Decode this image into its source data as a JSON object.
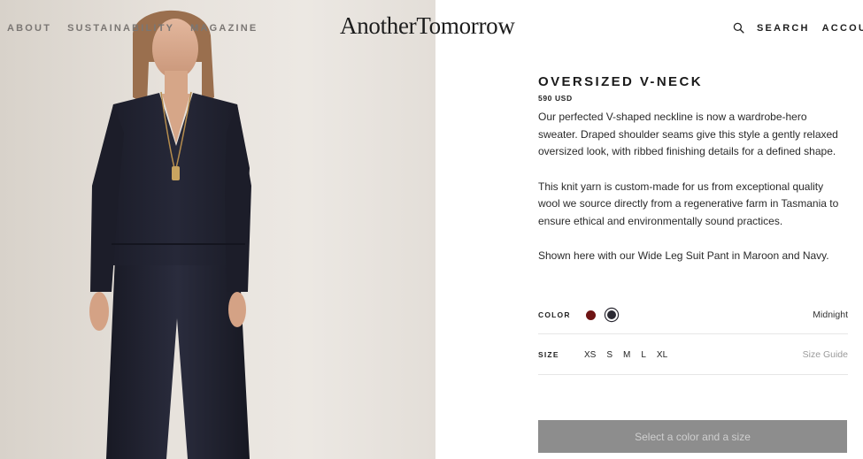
{
  "header": {
    "nav_left": [
      "ABOUT",
      "SUSTAINABILITY",
      "MAGAZINE"
    ],
    "logo": "AnotherTomorrow",
    "search_label": "SEARCH",
    "account_label": "ACCOU"
  },
  "product": {
    "title": "OVERSIZED V-NECK",
    "price": "590 USD",
    "description": [
      "Our perfected V-shaped neckline is now a wardrobe-hero sweater. Draped shoulder seams give this style a gently relaxed oversized look, with ribbed finishing details for a defined shape.",
      "This knit yarn is custom-made for us from exceptional quality wool we source directly from a regenerative farm in Tasmania to ensure ethical and environmentally sound practices.",
      "Shown here with our Wide Leg Suit Pant in Maroon and Navy."
    ]
  },
  "options": {
    "color_label": "COLOR",
    "colors": [
      {
        "name": "Maroon",
        "hex": "#6e1414",
        "selected": false
      },
      {
        "name": "Midnight",
        "hex": "#2b2a33",
        "selected": true
      }
    ],
    "selected_color_name": "Midnight",
    "size_label": "SIZE",
    "sizes": [
      "XS",
      "S",
      "M",
      "L",
      "XL"
    ],
    "size_guide": "Size Guide"
  },
  "cta": {
    "label": "Select a color and a size",
    "enabled": false
  },
  "colors": {
    "cta_bg": "#8d8d8d",
    "cta_text": "#cfcfcf",
    "nav_left": "#7a7673"
  }
}
